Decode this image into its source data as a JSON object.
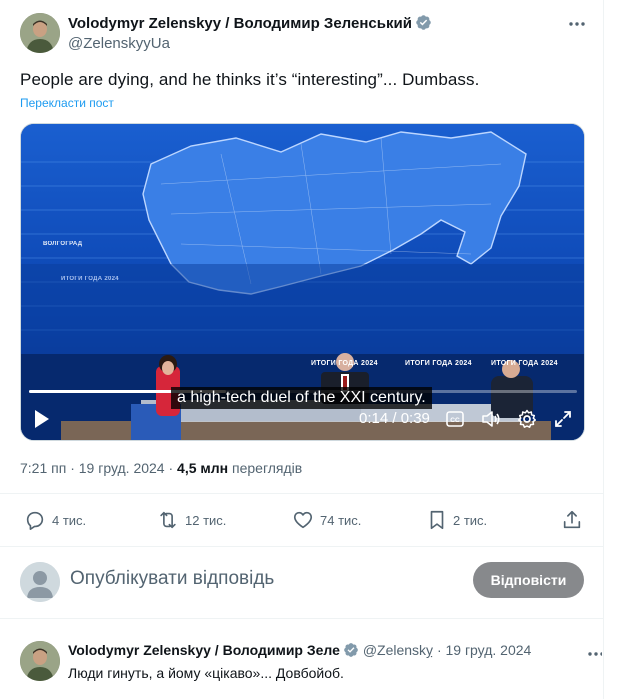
{
  "post": {
    "author_name": "Volodymyr Zelenskyy / Володимир Зеленський",
    "handle": "@ZelenskyyUa",
    "text": "People are dying, and he thinks it’s “interesting”... Dumbass.",
    "translate_link": "Перекласти пост",
    "time": "7:21 пп",
    "date": "19 груд. 2024",
    "views_count": "4,5 млн",
    "views_label": "переглядів"
  },
  "video": {
    "caption": "a high-tech duel of the XXI century.",
    "time_display": "0:14 / 0:39",
    "progress": 0.36,
    "overlay_texts": [
      "ИТОГИ ГОДА 2024",
      "ИТОГИ ГОДА 2024",
      "ИТОГИ ГОДА 2024",
      "ВОЛГОГРАД",
      "ИТОГИ ГОДА 2024"
    ]
  },
  "actions": {
    "replies": "4 тис.",
    "reposts": "12 тис.",
    "likes": "74 тис.",
    "bookmarks": "2 тис."
  },
  "reply_box": {
    "placeholder": "Опублікувати відповідь",
    "button_label": "Відповісти"
  },
  "reply": {
    "author_name": "Volodymyr Zelenskyy / Володимир Зеле",
    "handle": "@Zelenskỵ",
    "date": "· 19 груд. 2024",
    "text": "Люди гинуть, а йому «цікаво»... Довбойоб."
  },
  "colors": {
    "accent": "#1d9bf0",
    "muted": "#536471",
    "verified_badge": "#829aab",
    "reply_button": "#87898c",
    "video_blue": "#0a3fa0"
  },
  "icons": [
    "more-icon",
    "verified-icon",
    "play-icon",
    "captions-icon",
    "volume-icon",
    "settings-icon",
    "fullscreen-icon",
    "reply-icon",
    "repost-icon",
    "like-icon",
    "bookmark-icon",
    "share-icon"
  ]
}
